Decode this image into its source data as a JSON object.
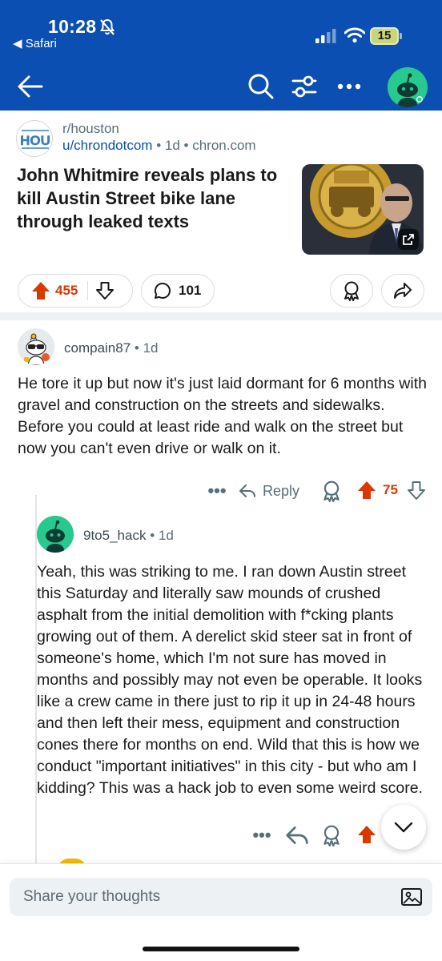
{
  "status_bar": {
    "time": "10:28",
    "back_app": "◀ Safari",
    "battery": "15"
  },
  "nav": {
    "icons": [
      "back-arrow-icon",
      "search-icon",
      "filter-icon",
      "more-icon",
      "profile-avatar"
    ]
  },
  "post": {
    "subreddit": "r/houston",
    "author": "u/chrondotcom",
    "age": "1d",
    "domain": "chron.com",
    "separator": "•",
    "title": "John Whitmire reveals plans to kill Austin Street bike lane through leaked texts",
    "score": "455",
    "comments": "101"
  },
  "comments": [
    {
      "author": "compain87",
      "age": "1d",
      "body": "He tore it up but now it's just laid dormant for 6 months with gravel and construction on the streets and sidewalks. Before you could at least ride and walk on the street but now you can't even drive or walk on it.",
      "more": "•••",
      "reply_label": "Reply",
      "score": "75"
    },
    {
      "author": "9to5_hack",
      "age": "1d",
      "body": "Yeah, this was striking to me. I ran down Austin street this Saturday and literally saw mounds of crushed asphalt from the initial demolition with f*cking plants growing out of them. A derelict skid steer sat in front of someone's home, which I'm not sure has moved in months and possibly may not even be operable. It looks like a crew came in there just to rip it up in 24-48 hours and then left their mess, equipment and construction cones there for months on end. Wild that this is how we conduct \"important initiatives\" in this city - but who am I kidding? This was a hack job to even some weird score.",
      "more": "•••"
    }
  ],
  "composer": {
    "placeholder": "Share your thoughts"
  },
  "colors": {
    "header_blue": "#0a4fb1",
    "upvote_orange": "#d93900",
    "meta_gray": "#576f76",
    "avatar_green": "#27c98f"
  }
}
